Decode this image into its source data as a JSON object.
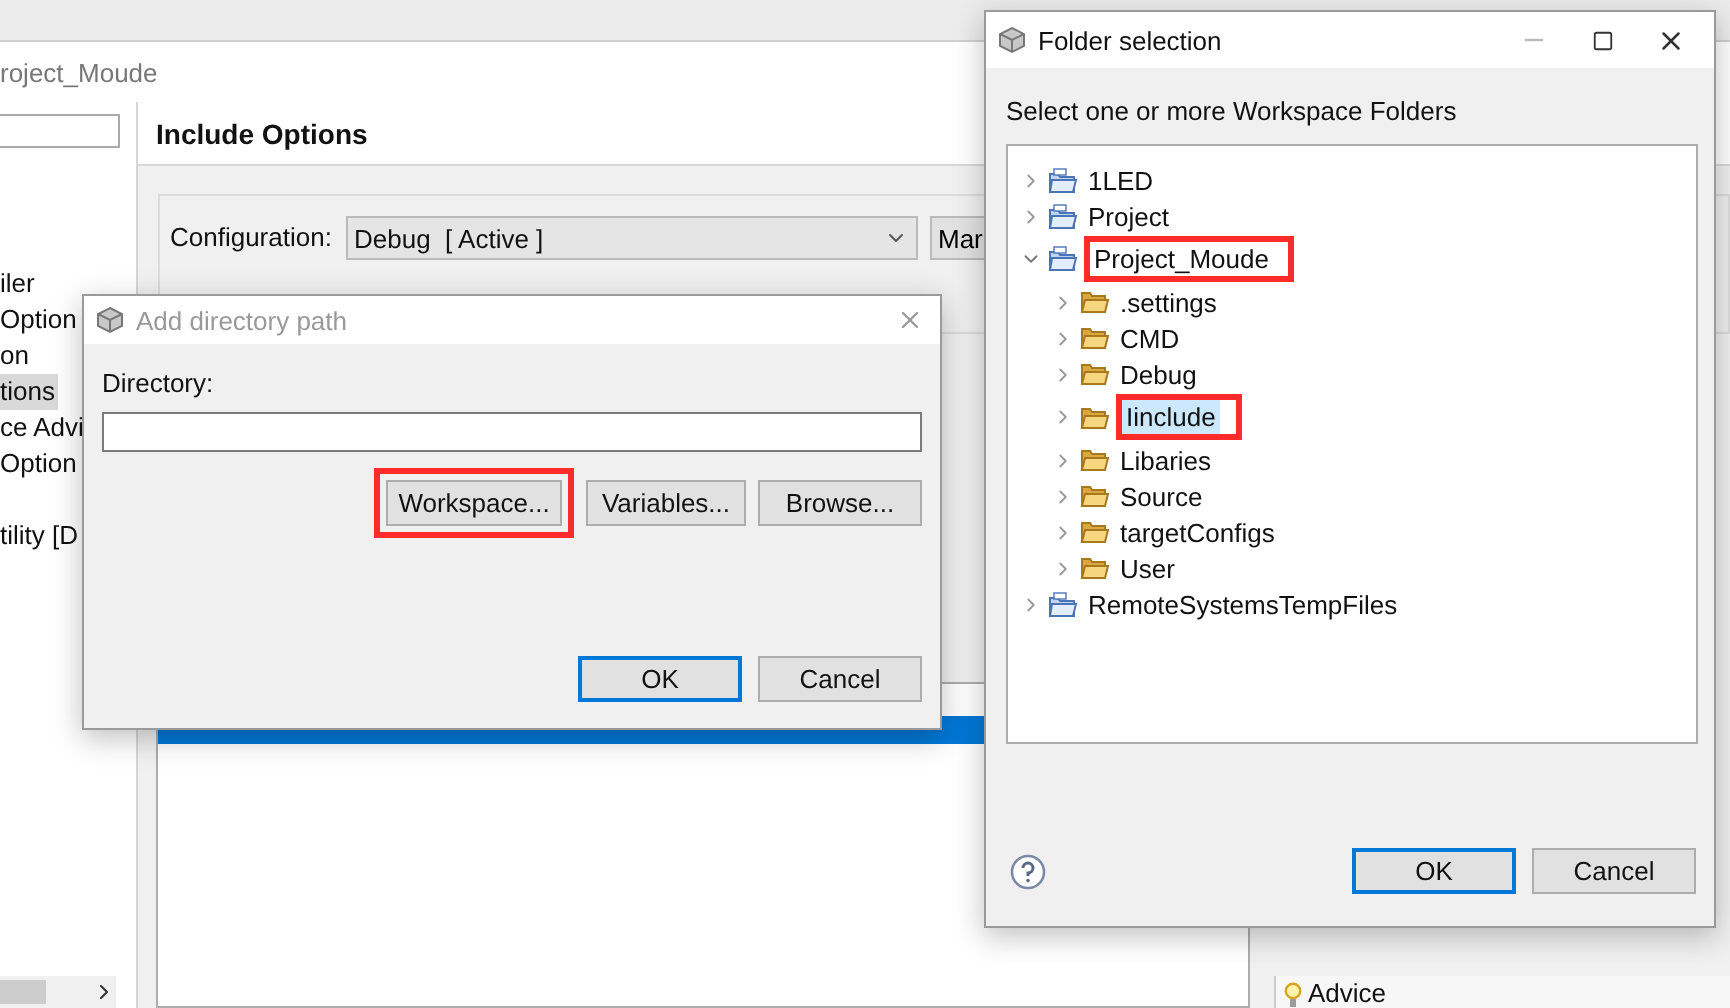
{
  "main_window": {
    "title": "roject_Moude",
    "sidebar": {
      "groups": [
        {
          "items": [
            {
              "label": "iler",
              "selected": false
            },
            {
              "label": "Option",
              "selected": false
            },
            {
              "label": "on",
              "selected": false
            },
            {
              "label": "tions",
              "selected": true
            },
            {
              "label": "ce Advi",
              "selected": false
            },
            {
              "label": "Option",
              "selected": false
            }
          ]
        },
        {
          "items": [
            {
              "label": "tility  [D",
              "selected": false
            }
          ]
        }
      ]
    },
    "page_title": "Include Options",
    "configuration": {
      "label": "Configuration:",
      "value": "Debug  [ Active ]",
      "button": "Mar"
    },
    "include_paths": [
      {
        "selected": true
      }
    ],
    "advice_tab": "Advice"
  },
  "add_directory_dialog": {
    "title": "Add directory path",
    "directory_label": "Directory:",
    "buttons": [
      {
        "label": "Workspace...",
        "highlighted": true
      },
      {
        "label": "Variables...",
        "highlighted": false
      },
      {
        "label": "Browse...",
        "highlighted": false
      }
    ],
    "footer_buttons": [
      {
        "label": "OK",
        "default": true
      },
      {
        "label": "Cancel",
        "default": false
      }
    ]
  },
  "folder_dialog": {
    "title": "Folder selection",
    "prompt": "Select one or more Workspace Folders",
    "tree": [
      {
        "label": "1LED",
        "kind": "project",
        "expanded": false,
        "selected": false,
        "highlighted": false
      },
      {
        "label": "Project",
        "kind": "project",
        "expanded": false,
        "selected": false,
        "highlighted": false
      },
      {
        "label": "Project_Moude",
        "kind": "project",
        "expanded": true,
        "selected": false,
        "highlighted": true,
        "children": [
          {
            "label": ".settings",
            "kind": "folder",
            "expanded": false,
            "selected": false,
            "highlighted": false
          },
          {
            "label": "CMD",
            "kind": "folder",
            "expanded": false,
            "selected": false,
            "highlighted": false
          },
          {
            "label": "Debug",
            "kind": "folder",
            "expanded": false,
            "selected": false,
            "highlighted": false
          },
          {
            "label": "Iinclude",
            "kind": "folder",
            "expanded": false,
            "selected": true,
            "highlighted": true
          },
          {
            "label": "Libaries",
            "kind": "folder",
            "expanded": false,
            "selected": false,
            "highlighted": false
          },
          {
            "label": "Source",
            "kind": "folder",
            "expanded": false,
            "selected": false,
            "highlighted": false
          },
          {
            "label": "targetConfigs",
            "kind": "folder",
            "expanded": false,
            "selected": false,
            "highlighted": false
          },
          {
            "label": "User",
            "kind": "folder",
            "expanded": false,
            "selected": false,
            "highlighted": false
          }
        ]
      },
      {
        "label": "RemoteSystemsTempFiles",
        "kind": "project",
        "expanded": false,
        "selected": false,
        "highlighted": false
      }
    ],
    "footer_buttons": [
      {
        "label": "OK",
        "default": true
      },
      {
        "label": "Cancel",
        "default": false
      }
    ]
  }
}
